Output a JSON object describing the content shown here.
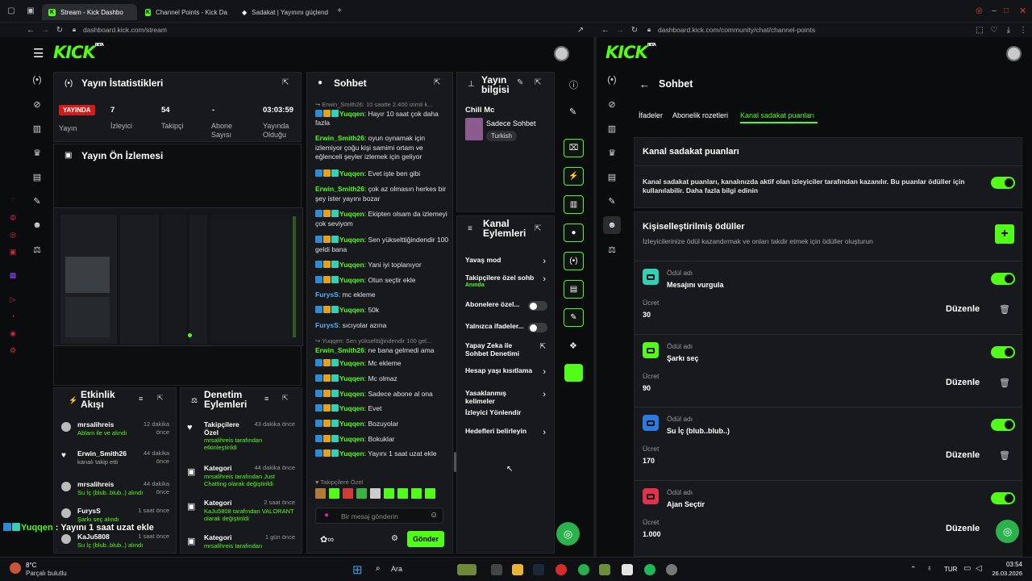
{
  "browser": {
    "tabs": [
      {
        "label": "Stream - Kick Dashbo"
      },
      {
        "label": "Channel Points - Kick Da"
      },
      {
        "label": "Sadakat | Yayınını güçlend"
      }
    ],
    "left_url": "dashboard.kick.com/stream",
    "right_url": "dashboard.kick.com/community/chat/channel-points"
  },
  "stats": {
    "title": "Yayın İstatistikleri",
    "live_badge": "YAYINDA",
    "items": [
      {
        "value": "",
        "label": "Yayın"
      },
      {
        "value": "7",
        "label": "İzleyici"
      },
      {
        "value": "54",
        "label": "Takipçi"
      },
      {
        "value": "-",
        "label": "Abone Sayısı"
      },
      {
        "value": "03:03:59",
        "label": "Yayında Olduğu"
      }
    ]
  },
  "preview": {
    "title": "Yayın Ön İzlemesi"
  },
  "chat": {
    "title": "Sohbet",
    "lines": [
      {
        "sys": "Erwin_Smith26: 10 saatte 2.400 izimli k...",
        "user": "Yuqqen",
        "text": "Hayır 10 saat çok daha fazla"
      },
      {
        "user": "Erwin_Smith26",
        "text": "oyun oynamak için izlemiyor çoğu kişi samimi ortam ve eğlenceli şeyler izlemek için geliyor"
      },
      {
        "user": "Yuqqen",
        "text": "Evet işte ben gibi"
      },
      {
        "user": "Erwin_Smith26",
        "text": "çok az olmasın herkes bir şey ister yayını bozar"
      },
      {
        "user": "Yuqqen",
        "text": "Ekipten olsam da izlemeyi çok seviyom"
      },
      {
        "user": "Yuqqen",
        "text": "Sen yükselttiğindendir 100 geldi bana"
      },
      {
        "user": "Yuqqen",
        "text": "Yani iyi toplanıyor"
      },
      {
        "user": "Yuqqen",
        "text": "Otun seçtir ekle"
      },
      {
        "user": "FurysS",
        "text": "mc ekleme"
      },
      {
        "user": "Yuqqen",
        "text": "50k"
      },
      {
        "user": "FurysS",
        "text": "sıcıyolar azına"
      },
      {
        "sys": "Yuqqen: Sen yükselttiğindendir 100 gel...",
        "user": "Erwin_Smith26",
        "text": "ne bana gelmedi ama"
      },
      {
        "user": "Yuqqen",
        "text": "Mc ekleme"
      },
      {
        "user": "Yuqqen",
        "text": "Mc olmaz"
      },
      {
        "user": "Yuqqen",
        "text": "Sadece abone al ona"
      },
      {
        "user": "Yuqqen",
        "text": "Evet"
      },
      {
        "user": "Yuqqen",
        "text": "Bozuyolar"
      },
      {
        "user": "Yuqqen",
        "text": "Bokuklar"
      },
      {
        "user": "Yuqqen",
        "text": "Yayını 1 saat uzat ekle"
      }
    ],
    "followers_only": "Takipçilere Özel",
    "input_placeholder": "Bir mesaj gönderin",
    "send": "Gönder"
  },
  "stream_info": {
    "title": "Yayın bilgisi",
    "stream_title": "Chill Mc",
    "category": "Sadece Sohbet",
    "tag": "Turkish"
  },
  "actions": {
    "title": "Kanal Eylemleri",
    "items": [
      {
        "label": "Yavaş mod"
      },
      {
        "label": "Takipçilere özel sohb",
        "sub": "Anında"
      },
      {
        "label": "Abonelere özel..."
      },
      {
        "label": "Yalnızca ifadeler..."
      },
      {
        "label": "Yapay Zeka ile Sohbet Denetimi"
      },
      {
        "label": "Hesap yaşı kısıtlama"
      },
      {
        "label": "Yasaklanmış kelimeler"
      },
      {
        "label": "İzleyici Yönlendir"
      },
      {
        "label": "Hedefleri belirleyin"
      }
    ]
  },
  "activity": {
    "title": "Etkinlik Akışı",
    "items": [
      {
        "user": "mrsalihreis",
        "time": "12 dakika önce",
        "detail": "Ablam ile ve alındı"
      },
      {
        "user": "Erwin_Smith26",
        "time": "44 dakika önce",
        "detail": "kanalı takip etti"
      },
      {
        "user": "mrsalihreis",
        "time": "44 dakika önce",
        "detail": "Su İç (blub..blub..) alındı"
      },
      {
        "user": "FurysS",
        "time": "1 saat önce",
        "detail": "Şarkı seç alındı"
      },
      {
        "user": "KaJu5808",
        "time": "1 saat önce",
        "detail": "Su İç (blub..blub..) alındı"
      }
    ]
  },
  "moderation": {
    "title": "Denetim Eylemleri",
    "items": [
      {
        "title": "Takipçilere Özel",
        "time": "43 dakika önce",
        "detail": "mrsalihreis tarafından etkinleştirildi"
      },
      {
        "title": "Kategori",
        "time": "44 dakika önce",
        "detail": "mrsalihreis tarafından Just Chatting olarak değiştirildi"
      },
      {
        "title": "Kategori",
        "time": "2 saat önce",
        "detail": "KaJu5808 tarafından VALORANT olarak değiştirildi"
      },
      {
        "title": "Kategori",
        "time": "1 gün önce",
        "detail": "mrsalihreis tarafından"
      }
    ]
  },
  "overlay_chat": {
    "user": "Yuqqen",
    "text": "Yayını 1 saat uzat ekle"
  },
  "right": {
    "back_title": "Sohbet",
    "tabs": [
      "İfadeler",
      "Abonelik rozetleri",
      "Kanal sadakat puanları"
    ],
    "points_title": "Kanal sadakat puanları",
    "points_desc": "Kanal sadakat puanları, kanalınızda aktif olan izleyiciler tarafından kazanılır. Bu puanlar ödüller için kullanılabilir. Daha fazla bilgi edinin",
    "custom_title": "Kişiselleştirilmiş ödüller",
    "custom_desc": "İzleyicilerinize ödül kazandırmak ve onları takdir etmek için ödüller oluşturun",
    "reward_name_label": "Ödül adı",
    "cost_label": "Ücret",
    "edit_label": "Düzenle",
    "rewards": [
      {
        "name": "Mesajını vurgula",
        "cost": "30",
        "color": "#31d1b6"
      },
      {
        "name": "Şarkı seç",
        "cost": "90",
        "color": "#53fc18"
      },
      {
        "name": "Su İç (blub..blub..)",
        "cost": "170",
        "color": "#2a7ae2"
      },
      {
        "name": "Ajan Seçtir",
        "cost": "1.000",
        "color": "#e0314d"
      }
    ]
  },
  "taskbar": {
    "weather_temp": "8°C",
    "weather_text": "Parçalı bulutlu",
    "search": "Ara",
    "lang": "TUR",
    "time": "03:54",
    "date": "26.03.2026"
  }
}
